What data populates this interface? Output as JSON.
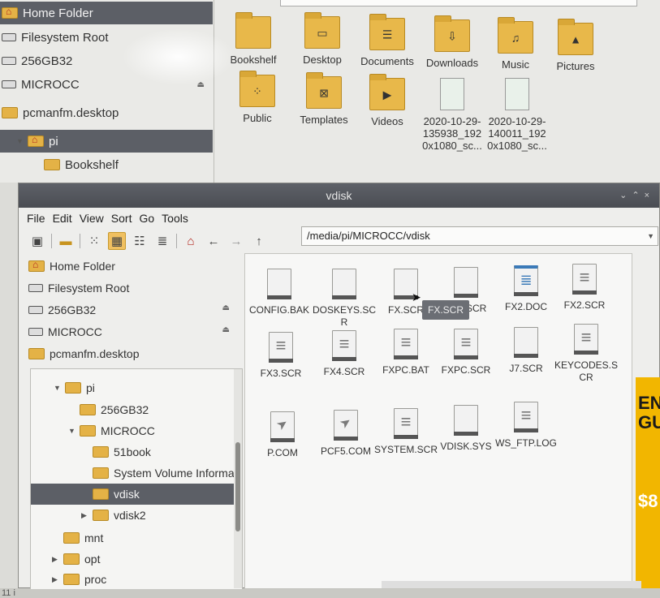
{
  "bg_window": {
    "sidebar": [
      {
        "label": "Home Folder",
        "icon": "home-folder-icon",
        "selected": true
      },
      {
        "label": "Filesystem Root",
        "icon": "drive-icon"
      },
      {
        "label": "256GB32",
        "icon": "drive-icon"
      },
      {
        "label": "MICROCC",
        "icon": "drive-icon"
      },
      {
        "label": "pcmanfm.desktop",
        "icon": "folder-icon"
      }
    ],
    "tree": [
      {
        "label": "pi",
        "selected": true
      },
      {
        "label": "Bookshelf"
      }
    ],
    "items": [
      {
        "label": "Bookshelf",
        "icon": "folder-icon"
      },
      {
        "label": "Desktop",
        "icon": "desktop-folder-icon"
      },
      {
        "label": "Documents",
        "icon": "documents-folder-icon"
      },
      {
        "label": "Downloads",
        "icon": "downloads-folder-icon"
      },
      {
        "label": "Music",
        "icon": "music-folder-icon"
      },
      {
        "label": "Pictures",
        "icon": "pictures-folder-icon"
      },
      {
        "label": "Public",
        "icon": "public-folder-icon"
      },
      {
        "label": "Templates",
        "icon": "templates-folder-icon"
      },
      {
        "label": "Videos",
        "icon": "videos-folder-icon"
      },
      {
        "label": "2020-10-29-135938_1920x1080_sc...",
        "icon": "image-file-icon"
      },
      {
        "label": "2020-10-29-140011_1920x1080_sc...",
        "icon": "image-file-icon"
      }
    ]
  },
  "window": {
    "title": "vdisk",
    "menu": [
      "File",
      "Edit",
      "View",
      "Sort",
      "Go",
      "Tools"
    ],
    "location": "/media/pi/MICROCC/vdisk",
    "places": [
      {
        "label": "Home Folder",
        "icon": "home-folder-icon"
      },
      {
        "label": "Filesystem Root",
        "icon": "drive-icon"
      },
      {
        "label": "256GB32",
        "icon": "drive-icon",
        "eject": true
      },
      {
        "label": "MICROCC",
        "icon": "drive-icon",
        "eject": true
      },
      {
        "label": "pcmanfm.desktop",
        "icon": "folder-icon"
      }
    ],
    "tree": [
      {
        "label": "pi",
        "expanded": true,
        "home": true
      },
      {
        "label": "256GB32"
      },
      {
        "label": "MICROCC",
        "expanded": true
      },
      {
        "label": "51book"
      },
      {
        "label": "System Volume Informa"
      },
      {
        "label": "vdisk",
        "selected": true
      },
      {
        "label": "vdisk2"
      },
      {
        "label": "mnt"
      },
      {
        "label": "opt"
      },
      {
        "label": "proc"
      }
    ],
    "files": [
      {
        "label": "CONFIG.BAK",
        "icon": "blank-file-icon"
      },
      {
        "label": "DOSKEYS.SCR",
        "icon": "blank-file-icon"
      },
      {
        "label": "FX.SCR",
        "icon": "blank-file-icon"
      },
      {
        "label": "FX1.SCR",
        "icon": "blank-file-icon"
      },
      {
        "label": "FX2.DOC",
        "icon": "document-file-icon"
      },
      {
        "label": "FX2.SCR",
        "icon": "text-file-icon"
      },
      {
        "label": "FX3.SCR",
        "icon": "text-file-icon"
      },
      {
        "label": "FX4.SCR",
        "icon": "text-file-icon"
      },
      {
        "label": "FXPC.BAT",
        "icon": "text-file-icon"
      },
      {
        "label": "FXPC.SCR",
        "icon": "text-file-icon"
      },
      {
        "label": "J7.SCR",
        "icon": "blank-file-icon"
      },
      {
        "label": "KEYCODES.SCR",
        "icon": "text-file-icon"
      },
      {
        "label": "P.COM",
        "icon": "executable-file-icon"
      },
      {
        "label": "PCF5.COM",
        "icon": "executable-file-icon"
      },
      {
        "label": "SYSTEM.SCR",
        "icon": "text-file-icon"
      },
      {
        "label": "VDISK.SYS",
        "icon": "blank-file-icon"
      },
      {
        "label": "WS_FTP.LOG",
        "icon": "text-file-icon"
      }
    ],
    "tooltip": "FX.SCR"
  },
  "left_edge_label": "11 i",
  "ad": {
    "text": "EN GU",
    "price": "$8"
  }
}
